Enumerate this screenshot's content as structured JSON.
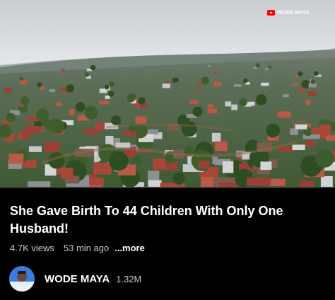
{
  "video": {
    "watermark_text": "WODE MAYA",
    "watermark_icon": "youtube-logo-icon",
    "progress_fraction": 0.0
  },
  "title": "She Gave Birth To 44 Children With Only One Husband!",
  "meta": {
    "views": "4.7K views",
    "time_ago": "53 min ago",
    "more_label": "...more"
  },
  "channel": {
    "name": "WODE MAYA",
    "subscribers": "1.32M",
    "avatar_icon": "channel-avatar"
  },
  "colors": {
    "background": "#000000",
    "accent": "#ff0000",
    "secondary_text": "#c8c8c8"
  }
}
